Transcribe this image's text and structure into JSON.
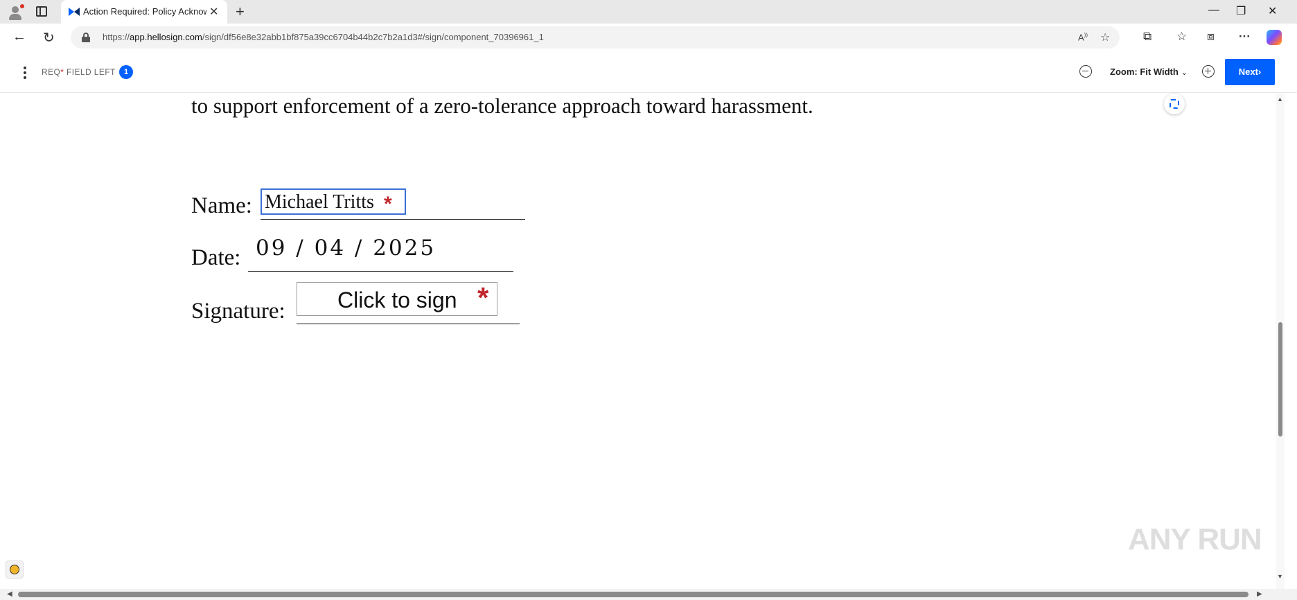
{
  "browser": {
    "tab_title": "Action Required: Policy Acknowle",
    "url_prefix": "https://",
    "url_domain": "app.hellosign.com",
    "url_path": "/sign/df56e8e32abb1bf875a39cc6704b44b2c7b2a1d3#/sign/component_70396961_1",
    "new_tab_symbol": "+",
    "close_tab_symbol": "✕",
    "window_controls": {
      "minimize": "—",
      "restore": "❐",
      "close": "✕"
    },
    "nav": {
      "back": "←",
      "reload": "↻"
    },
    "toolbar_icons": [
      "read-aloud-icon",
      "favorite-star-icon",
      "extensions-icon",
      "favorites-icon",
      "collections-icon",
      "more-icon",
      "copilot-icon"
    ]
  },
  "header": {
    "req_prefix": "REQ",
    "req_star": "*",
    "req_suffix": " FIELD LEFT",
    "fields_left": "1",
    "zoom_label": "Zoom: Fit Width",
    "zoom_chevron": "⌄",
    "next_label": "Next",
    "next_chevron": "›"
  },
  "document": {
    "top_line": "to support enforcement of a zero-tolerance approach toward harassment.",
    "name_label": "Name:",
    "name_value": "Michael Tritts",
    "date_label": "Date:",
    "date_value": "09 / 04 / 2025",
    "signature_label": "Signature:",
    "signature_placeholder": "Click to sign",
    "required_mark": "*"
  },
  "watermark": "ANY RUN",
  "colors": {
    "accent": "#0061fe",
    "required": "#c0262d",
    "field_focus": "#3b6fd6"
  }
}
